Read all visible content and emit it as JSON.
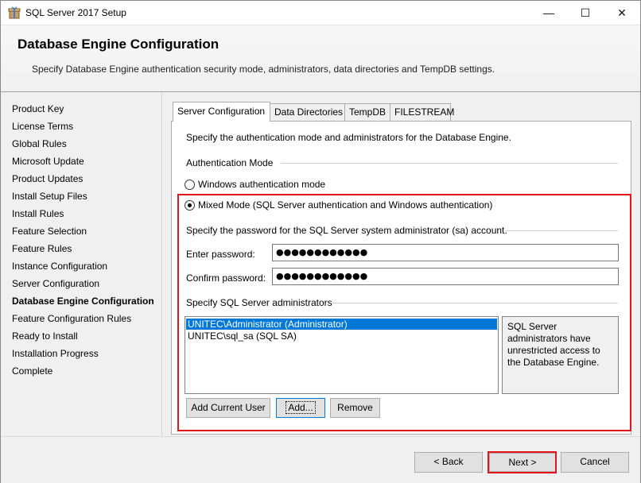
{
  "window": {
    "title": "SQL Server 2017 Setup",
    "minimize": "—",
    "maximize": "☐",
    "close": "✕"
  },
  "header": {
    "title": "Database Engine Configuration",
    "subtitle": "Specify Database Engine authentication security mode, administrators, data directories and TempDB settings."
  },
  "nav": {
    "items": [
      {
        "label": "Product Key",
        "active": false
      },
      {
        "label": "License Terms",
        "active": false
      },
      {
        "label": "Global Rules",
        "active": false
      },
      {
        "label": "Microsoft Update",
        "active": false
      },
      {
        "label": "Product Updates",
        "active": false
      },
      {
        "label": "Install Setup Files",
        "active": false
      },
      {
        "label": "Install Rules",
        "active": false
      },
      {
        "label": "Feature Selection",
        "active": false
      },
      {
        "label": "Feature Rules",
        "active": false
      },
      {
        "label": "Instance Configuration",
        "active": false
      },
      {
        "label": "Server Configuration",
        "active": false
      },
      {
        "label": "Database Engine Configuration",
        "active": true
      },
      {
        "label": "Feature Configuration Rules",
        "active": false
      },
      {
        "label": "Ready to Install",
        "active": false
      },
      {
        "label": "Installation Progress",
        "active": false
      },
      {
        "label": "Complete",
        "active": false
      }
    ]
  },
  "tabs": [
    {
      "label": "Server Configuration",
      "active": true
    },
    {
      "label": "Data Directories",
      "active": false
    },
    {
      "label": "TempDB",
      "active": false
    },
    {
      "label": "FILESTREAM",
      "active": false
    }
  ],
  "panel": {
    "intro": "Specify the authentication mode and administrators for the Database Engine.",
    "auth_mode_label": "Authentication Mode",
    "radio_windows": "Windows authentication mode",
    "radio_mixed": "Mixed Mode (SQL Server authentication and Windows authentication)",
    "selected_mode": "mixed",
    "sa_password_label": "Specify the password for the SQL Server system administrator (sa) account.",
    "enter_password_label": "Enter password:",
    "enter_password_value": "●●●●●●●●●●●●",
    "confirm_password_label": "Confirm password:",
    "confirm_password_value": "●●●●●●●●●●●●",
    "admins_label": "Specify SQL Server administrators",
    "admins": [
      {
        "name": "UNITEC\\Administrator (Administrator)",
        "selected": true
      },
      {
        "name": "UNITEC\\sql_sa (SQL SA)",
        "selected": false
      }
    ],
    "admins_info": "SQL Server administrators have unrestricted access to the Database Engine.",
    "add_current_user": "Add Current User",
    "add": "Add...",
    "remove": "Remove"
  },
  "footer": {
    "back": "< Back",
    "next": "Next >",
    "cancel": "Cancel"
  },
  "colors": {
    "highlight": "#e3151a",
    "selection": "#0078d7"
  }
}
